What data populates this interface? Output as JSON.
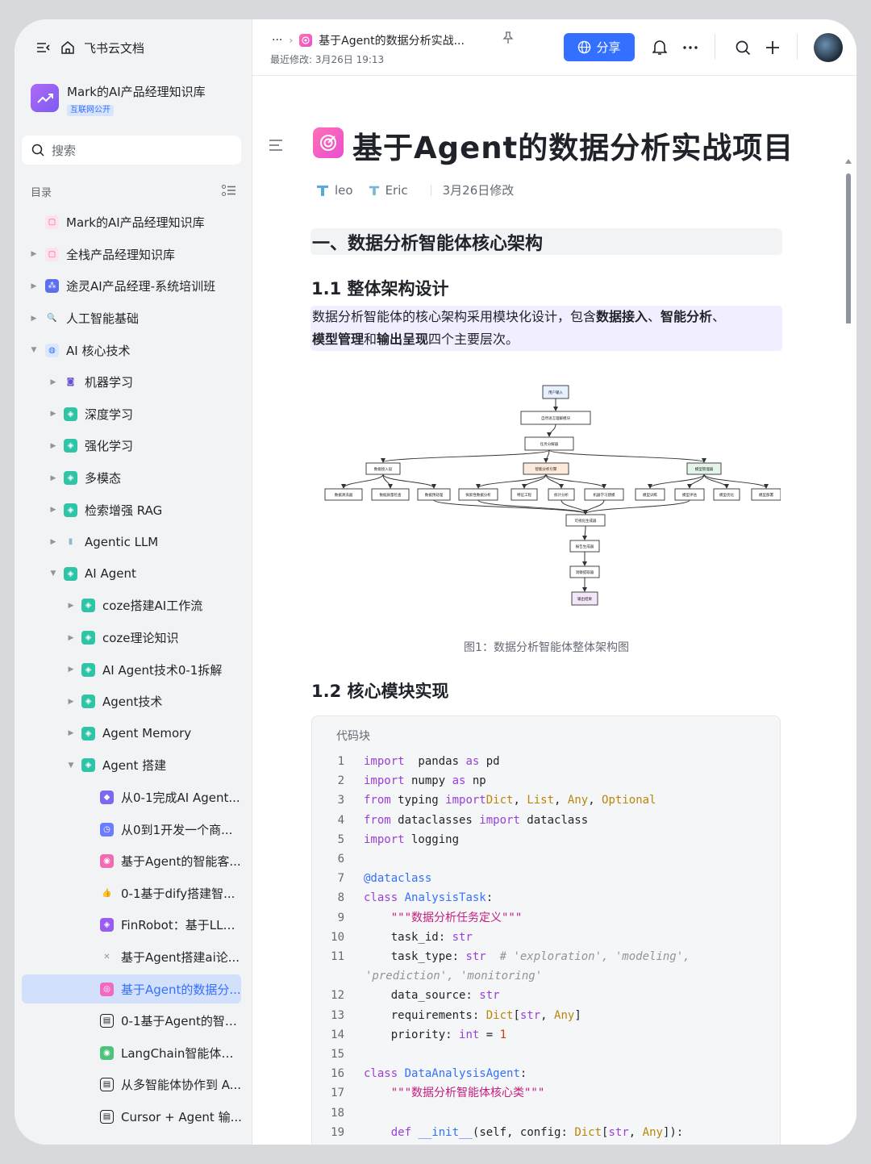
{
  "app": {
    "name": "飞书云文档"
  },
  "knowledge_base": {
    "title": "Mark的AI产品经理知识库",
    "badge": "互联网公开"
  },
  "search": {
    "placeholder": "搜索"
  },
  "toc": {
    "label": "目录"
  },
  "tree": [
    {
      "label": "Mark的AI产品经理知识库",
      "level": 0,
      "arrow": "",
      "icon": "pink",
      "active": false
    },
    {
      "label": "全栈产品经理知识库",
      "level": 0,
      "arrow": "▶",
      "icon": "pink",
      "active": false
    },
    {
      "label": "途灵AI产品经理-系统培训班",
      "level": 0,
      "arrow": "▶",
      "icon": "blue",
      "active": false
    },
    {
      "label": "人工智能基础",
      "level": 0,
      "arrow": "▶",
      "icon": "magnifier",
      "active": false
    },
    {
      "label": "AI 核心技术",
      "level": 0,
      "arrow": "▼",
      "icon": "globe",
      "active": false
    },
    {
      "label": "机器学习",
      "level": 1,
      "arrow": "▶",
      "icon": "robot",
      "active": false
    },
    {
      "label": "深度学习",
      "level": 1,
      "arrow": "▶",
      "icon": "teal",
      "active": false
    },
    {
      "label": "强化学习",
      "level": 1,
      "arrow": "▶",
      "icon": "teal",
      "active": false
    },
    {
      "label": "多模态",
      "level": 1,
      "arrow": "▶",
      "icon": "teal",
      "active": false
    },
    {
      "label": "检索增强 RAG",
      "level": 1,
      "arrow": "▶",
      "icon": "teal",
      "active": false
    },
    {
      "label": "Agentic LLM",
      "level": 1,
      "arrow": "▶",
      "icon": "bottle",
      "active": false
    },
    {
      "label": "AI Agent",
      "level": 1,
      "arrow": "▼",
      "icon": "teal",
      "active": false
    },
    {
      "label": "coze搭建AI工作流",
      "level": 2,
      "arrow": "▶",
      "icon": "teal",
      "active": false
    },
    {
      "label": "coze理论知识",
      "level": 2,
      "arrow": "▶",
      "icon": "teal",
      "active": false
    },
    {
      "label": "AI Agent技术0-1拆解",
      "level": 2,
      "arrow": "▶",
      "icon": "teal",
      "active": false
    },
    {
      "label": "Agent技术",
      "level": 2,
      "arrow": "▶",
      "icon": "teal",
      "active": false
    },
    {
      "label": "Agent Memory",
      "level": 2,
      "arrow": "▶",
      "icon": "teal",
      "active": false
    },
    {
      "label": "Agent 搭建",
      "level": 2,
      "arrow": "▼",
      "icon": "teal",
      "active": false
    },
    {
      "label": "从0-1完成AI Agent...",
      "level": 3,
      "arrow": "",
      "icon": "purple",
      "active": false
    },
    {
      "label": "从0到1开发一个商...",
      "level": 3,
      "arrow": "",
      "icon": "indigo",
      "active": false
    },
    {
      "label": "基于Agent的智能客...",
      "level": 3,
      "arrow": "",
      "icon": "gamepad",
      "active": false
    },
    {
      "label": "0-1基于dify搭建智...",
      "level": 3,
      "arrow": "",
      "icon": "thumb",
      "active": false
    },
    {
      "label": "FinRobot：基于LLM...",
      "level": 3,
      "arrow": "",
      "icon": "violet",
      "active": false
    },
    {
      "label": "基于Agent搭建ai论...",
      "level": 3,
      "arrow": "",
      "icon": "tools",
      "active": false
    },
    {
      "label": "基于Agent的数据分...",
      "level": 3,
      "arrow": "",
      "icon": "target",
      "active": true
    },
    {
      "label": "0-1基于Agent的智能...",
      "level": 3,
      "arrow": "",
      "icon": "doc",
      "active": false
    },
    {
      "label": "LangChain智能体开...",
      "level": 3,
      "arrow": "",
      "icon": "green",
      "active": false
    },
    {
      "label": "从多智能体协作到 A...",
      "level": 3,
      "arrow": "",
      "icon": "doc",
      "active": false
    },
    {
      "label": "Cursor + Agent 输...",
      "level": 3,
      "arrow": "",
      "icon": "doc",
      "active": false
    }
  ],
  "header": {
    "breadcrumb_more": "···",
    "breadcrumb_title": "基于Agent的数据分析实战...",
    "last_modified": "最近修改: 3月26日 19:13",
    "share_label": "分享"
  },
  "doc": {
    "title": "基于Agent的数据分析实战项目",
    "authors": [
      "leo",
      "Eric"
    ],
    "modified": "3月26日修改",
    "h1": "一、数据分析智能体核心架构",
    "h2_1": "1.1 整体架构设计",
    "para_pre": "数据分析智能体的核心架构采用模块化设计，包含",
    "para_b1": "数据接入",
    "para_s1": "、",
    "para_b2": "智能分析",
    "para_s2": "、",
    "para_b3": "模型管理",
    "para_s3": "和",
    "para_b4": "输出呈现",
    "para_post": "四个主要层次。",
    "caption": "图1：数据分析智能体整体架构图",
    "h2_2": "1.2 核心模块实现",
    "code_label": "代码块"
  },
  "diagram": {
    "nodes": [
      {
        "id": "n1",
        "label": "用户输入",
        "color": "#e6f0ff"
      },
      {
        "id": "n2",
        "label": "自然语言理解模块",
        "color": "#ffffff"
      },
      {
        "id": "n3",
        "label": "任务分解器",
        "color": "#ffffff"
      },
      {
        "id": "n4",
        "label": "数据接入层",
        "color": "#ffffff"
      },
      {
        "id": "n5",
        "label": "智能分析引擎",
        "color": "#fde9d9"
      },
      {
        "id": "n6",
        "label": "模型管理器",
        "color": "#e3f5e8"
      },
      {
        "id": "n7",
        "label": "数据清洗器",
        "color": "#ffffff"
      },
      {
        "id": "n8",
        "label": "数据质量检查",
        "color": "#ffffff"
      },
      {
        "id": "n9",
        "label": "数据预处理",
        "color": "#ffffff"
      },
      {
        "id": "n10",
        "label": "探索性数据分析",
        "color": "#ffffff"
      },
      {
        "id": "n11",
        "label": "特征工程",
        "color": "#ffffff"
      },
      {
        "id": "n12",
        "label": "统计分析",
        "color": "#ffffff"
      },
      {
        "id": "n13",
        "label": "机器学习建模",
        "color": "#ffffff"
      },
      {
        "id": "n14",
        "label": "模型训练",
        "color": "#ffffff"
      },
      {
        "id": "n15",
        "label": "模型评估",
        "color": "#ffffff"
      },
      {
        "id": "n16",
        "label": "模型优化",
        "color": "#ffffff"
      },
      {
        "id": "n17",
        "label": "模型部署",
        "color": "#ffffff"
      },
      {
        "id": "n18",
        "label": "可视化生成器",
        "color": "#ffffff"
      },
      {
        "id": "n19",
        "label": "报告生成器",
        "color": "#ffffff"
      },
      {
        "id": "n20",
        "label": "洞察提取器",
        "color": "#ffffff"
      },
      {
        "id": "n21",
        "label": "输出结果",
        "color": "#f3e6fa"
      }
    ]
  },
  "code": [
    {
      "n": "1",
      "parts": [
        [
          "kw",
          "import"
        ],
        [
          "",
          "  pandas "
        ],
        [
          "kw",
          "as"
        ],
        [
          "",
          " pd"
        ]
      ]
    },
    {
      "n": "2",
      "parts": [
        [
          "kw",
          "import"
        ],
        [
          "",
          " numpy "
        ],
        [
          "kw",
          "as"
        ],
        [
          "",
          " np"
        ]
      ]
    },
    {
      "n": "3",
      "parts": [
        [
          "kw",
          "from"
        ],
        [
          "",
          " typing "
        ],
        [
          "kw",
          "import"
        ],
        [
          " ",
          ""
        ],
        [
          "ty",
          "Dict"
        ],
        [
          "",
          ", "
        ],
        [
          "ty",
          "List"
        ],
        [
          "",
          ", "
        ],
        [
          "ty",
          "Any"
        ],
        [
          "",
          ", "
        ],
        [
          "ty",
          "Optional"
        ]
      ]
    },
    {
      "n": "4",
      "parts": [
        [
          "kw",
          "from"
        ],
        [
          "",
          " dataclasses "
        ],
        [
          "kw",
          "import"
        ],
        [
          "",
          " dataclass"
        ]
      ]
    },
    {
      "n": "5",
      "parts": [
        [
          "kw",
          "import"
        ],
        [
          "",
          " logging"
        ]
      ]
    },
    {
      "n": "6",
      "parts": []
    },
    {
      "n": "7",
      "parts": [
        [
          "dc",
          "@dataclass"
        ]
      ]
    },
    {
      "n": "8",
      "parts": [
        [
          "kw",
          "class"
        ],
        [
          "",
          " "
        ],
        [
          "fn",
          "AnalysisTask"
        ],
        [
          "",
          ":"
        ]
      ]
    },
    {
      "n": "9",
      "parts": [
        [
          "",
          "    "
        ],
        [
          "st",
          "\"\"\"数据分析任务定义\"\"\""
        ]
      ]
    },
    {
      "n": "10",
      "parts": [
        [
          "",
          "    task_id: "
        ],
        [
          "kw",
          "str"
        ]
      ]
    },
    {
      "n": "11",
      "parts": [
        [
          "",
          "    task_type: "
        ],
        [
          "kw",
          "str"
        ],
        [
          "",
          "  "
        ],
        [
          "cm",
          "# 'exploration', 'modeling',"
        ]
      ]
    },
    {
      "n": "",
      "parts": [
        [
          "cm",
          "'prediction', 'monitoring'"
        ]
      ],
      "wrap": true
    },
    {
      "n": "12",
      "parts": [
        [
          "",
          "    data_source: "
        ],
        [
          "kw",
          "str"
        ]
      ]
    },
    {
      "n": "13",
      "parts": [
        [
          "",
          "    requirements: "
        ],
        [
          "ty",
          "Dict"
        ],
        [
          "",
          "["
        ],
        [
          "kw",
          "str"
        ],
        [
          "",
          ", "
        ],
        [
          "ty",
          "Any"
        ],
        [
          "",
          "]"
        ]
      ]
    },
    {
      "n": "14",
      "parts": [
        [
          "",
          "    priority: "
        ],
        [
          "kw",
          "int"
        ],
        [
          "",
          " = "
        ],
        [
          "nm",
          "1"
        ]
      ]
    },
    {
      "n": "15",
      "parts": []
    },
    {
      "n": "16",
      "parts": [
        [
          "kw",
          "class"
        ],
        [
          "",
          " "
        ],
        [
          "fn",
          "DataAnalysisAgent"
        ],
        [
          "",
          ":"
        ]
      ]
    },
    {
      "n": "17",
      "parts": [
        [
          "",
          "    "
        ],
        [
          "st",
          "\"\"\"数据分析智能体核心类\"\"\""
        ]
      ]
    },
    {
      "n": "18",
      "parts": []
    },
    {
      "n": "19",
      "parts": [
        [
          "",
          "    "
        ],
        [
          "kw",
          "def"
        ],
        [
          "",
          " "
        ],
        [
          "fn",
          "__init__"
        ],
        [
          "",
          "(self, config: "
        ],
        [
          "ty",
          "Dict"
        ],
        [
          "",
          "["
        ],
        [
          "kw",
          "str"
        ],
        [
          "",
          ", "
        ],
        [
          "ty",
          "Any"
        ],
        [
          "",
          "]):"
        ]
      ]
    }
  ]
}
